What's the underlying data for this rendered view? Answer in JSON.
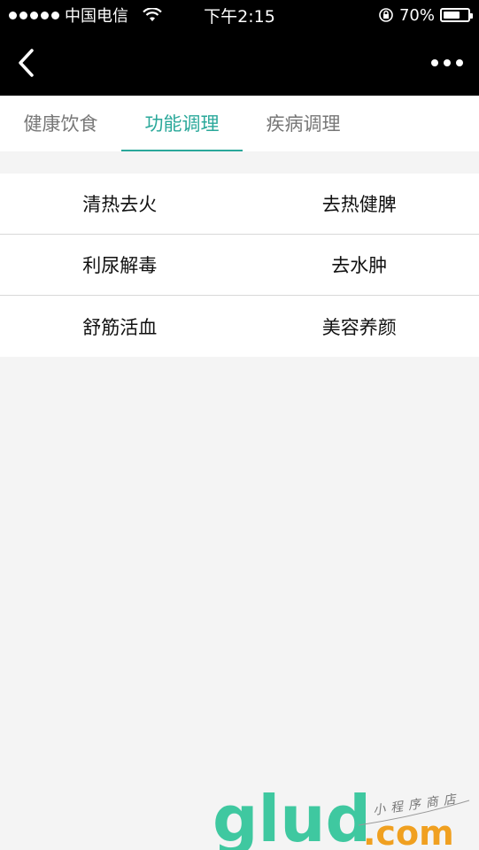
{
  "status_bar": {
    "carrier": "中国电信",
    "time": "下午2:15",
    "battery_percent": "70%",
    "battery_level": 0.7,
    "signal_icon": "signal-dots-icon",
    "wifi_icon": "wifi-icon",
    "orientation_icon": "orientation-lock-icon",
    "battery_icon": "battery-icon"
  },
  "nav": {
    "back_icon": "chevron-left-icon",
    "more_icon": "more-dots-icon"
  },
  "tabs": [
    {
      "label": "健康饮食",
      "active": false
    },
    {
      "label": "功能调理",
      "active": true
    },
    {
      "label": "疾病调理",
      "active": false
    }
  ],
  "grid": {
    "rows": [
      [
        "清热去火",
        "去热健脾"
      ],
      [
        "利尿解毒",
        "去水肿"
      ],
      [
        "舒筋活血",
        "美容养颜"
      ]
    ]
  },
  "watermark": {
    "logo_text": "glud",
    "domain_text": ".com",
    "tagline": "小程序商店"
  },
  "colors": {
    "accent": "#2aa89a",
    "topbar": "#000000",
    "background": "#f4f4f4",
    "watermark_green": "#3fc8a0",
    "watermark_orange": "#f0a020"
  }
}
